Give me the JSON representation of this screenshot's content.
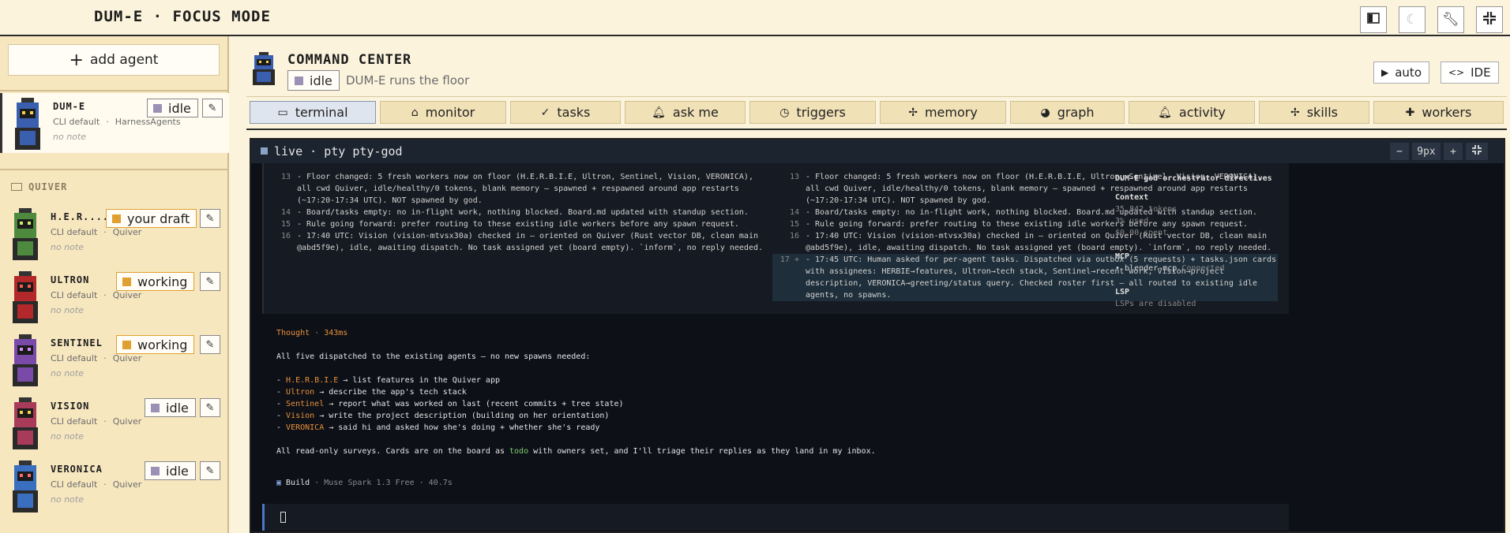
{
  "app": {
    "title": "DUM-E · FOCUS MODE"
  },
  "topbar": {
    "icons": [
      "sidebar-icon",
      "moon-icon",
      "wrench-icon",
      "focus-icon"
    ]
  },
  "sidebar": {
    "add_agent_label": "add agent",
    "group_label": "QUIVER",
    "agents": [
      {
        "name": "DUM-E",
        "status": "idle",
        "runtime": "CLI default",
        "project": "HarnessAgents",
        "note": "no note",
        "color": "#3a5fae"
      },
      {
        "name": "H.E.R....",
        "status": "your draft",
        "runtime": "CLI default",
        "project": "Quiver",
        "note": "no note",
        "color": "#4e8a3e"
      },
      {
        "name": "ULTRON",
        "status": "working",
        "runtime": "CLI default",
        "project": "Quiver",
        "note": "no note",
        "color": "#b3282a"
      },
      {
        "name": "SENTINEL",
        "status": "working",
        "runtime": "CLI default",
        "project": "Quiver",
        "note": "no note",
        "color": "#7a4aa8"
      },
      {
        "name": "VISION",
        "status": "idle",
        "runtime": "CLI default",
        "project": "Quiver",
        "note": "no note",
        "color": "#a83a5a"
      },
      {
        "name": "VERONICA",
        "status": "idle",
        "runtime": "CLI default",
        "project": "Quiver",
        "note": "no note",
        "color": "#3a6fc0"
      }
    ]
  },
  "main": {
    "title": "COMMAND CENTER",
    "status": "idle",
    "description": "DUM-E runs the floor",
    "auto_label": "auto",
    "ide_label": "IDE",
    "tabs": [
      {
        "label": "terminal",
        "icon": "terminal-icon"
      },
      {
        "label": "monitor",
        "icon": "monitor-icon"
      },
      {
        "label": "tasks",
        "icon": "check-icon"
      },
      {
        "label": "ask me",
        "icon": "bell-icon"
      },
      {
        "label": "triggers",
        "icon": "clock-icon"
      },
      {
        "label": "memory",
        "icon": "sparkle-icon"
      },
      {
        "label": "graph",
        "icon": "palette-icon"
      },
      {
        "label": "activity",
        "icon": "bell-icon"
      },
      {
        "label": "skills",
        "icon": "sparkle-icon"
      },
      {
        "label": "workers",
        "icon": "gear-icon"
      }
    ]
  },
  "terminal": {
    "title": "live · pty pty-god",
    "zoom_minus": "−",
    "zoom_value": "9px",
    "zoom_plus": "+",
    "diff_left": [
      {
        "ln": "13",
        "text": "- Floor changed: 5 fresh workers now on floor (H.E.R.B.I.E, Ultron, Sentinel, Vision, VERONICA), all cwd Quiver, idle/healthy/0 tokens, blank memory — spawned + respawned around app restarts (~17:20-17:34 UTC). NOT spawned by god."
      },
      {
        "ln": "14",
        "text": "- Board/tasks empty: no in-flight work, nothing blocked. Board.md updated with standup section."
      },
      {
        "ln": "15",
        "text": "- Rule going forward: prefer routing to these existing idle workers before any spawn request."
      },
      {
        "ln": "16",
        "text": "- 17:40 UTC: Vision (vision-mtvsx30a) checked in — oriented on Quiver (Rust vector DB, clean main @abd5f9e), idle, awaiting dispatch. No task assigned yet (board empty). `inform`, no reply needed."
      }
    ],
    "diff_right": [
      {
        "ln": "13",
        "text": "- Floor changed: 5 fresh workers now on floor (H.E.R.B.I.E, Ultron, Sentinel, Vision, VERONICA), all cwd Quiver, idle/healthy/0 tokens, blank memory — spawned + respawned around app restarts (~17:20-17:34 UTC). NOT spawned by god."
      },
      {
        "ln": "14",
        "text": "- Board/tasks empty: no in-flight work, nothing blocked. Board.md updated with standup section."
      },
      {
        "ln": "15",
        "text": "- Rule going forward: prefer routing to these existing idle workers before any spawn request."
      },
      {
        "ln": "16",
        "text": "- 17:40 UTC: Vision (vision-mtvsx30a) checked in — oriented on Quiver (Rust vector DB, clean main @abd5f9e), idle, awaiting dispatch. No task assigned yet (board empty). `inform`, no reply needed."
      },
      {
        "ln": "17 +",
        "text": "- 17:45 UTC: Human asked for per-agent tasks. Dispatched via outbox (5 requests) + tasks.json cards with assignees: HERBIE→features, Ultron→tech stack, Sentinel→recent work, Vision→project description, VERONICA→greeting/status query. Checked roster first — all routed to existing idle agents, no spawns."
      }
    ],
    "thought_label": "Thought",
    "thought_time": "343ms",
    "summary": "All five dispatched to the existing agents — no new spawns needed:",
    "dispatches": [
      {
        "name": "H.E.R.B.I.E",
        "task": "list features in the Quiver app"
      },
      {
        "name": "Ultron",
        "task": "describe the app's tech stack"
      },
      {
        "name": "Sentinel",
        "task": "report what was worked on last (recent commits + tree state)"
      },
      {
        "name": "Vision",
        "task": "write the project description (building on her orientation)"
      },
      {
        "name": "VERONICA",
        "task": "said hi and asked how she's doing + whether she's ready"
      }
    ],
    "closing_pre": "All read-only surveys. Cards are on the board as ",
    "closing_todo": "todo",
    "closing_post": " with owners set, and I'll triage their replies as they land in my inbox.",
    "build_label": "Build",
    "build_meta": "· Muse Spark 1.3 Free · 40.7s"
  },
  "side_panel": {
    "title": "DUM-E god orchestrator directives",
    "context_h": "Context",
    "tokens": "35,842 tokens",
    "used": "3% used",
    "spent": "$0.00 spent",
    "mcp_h": "MCP",
    "mcp_name": "• blender-mcp",
    "mcp_status": "Connected",
    "lsp_h": "LSP",
    "lsp_text": "LSPs are disabled"
  }
}
